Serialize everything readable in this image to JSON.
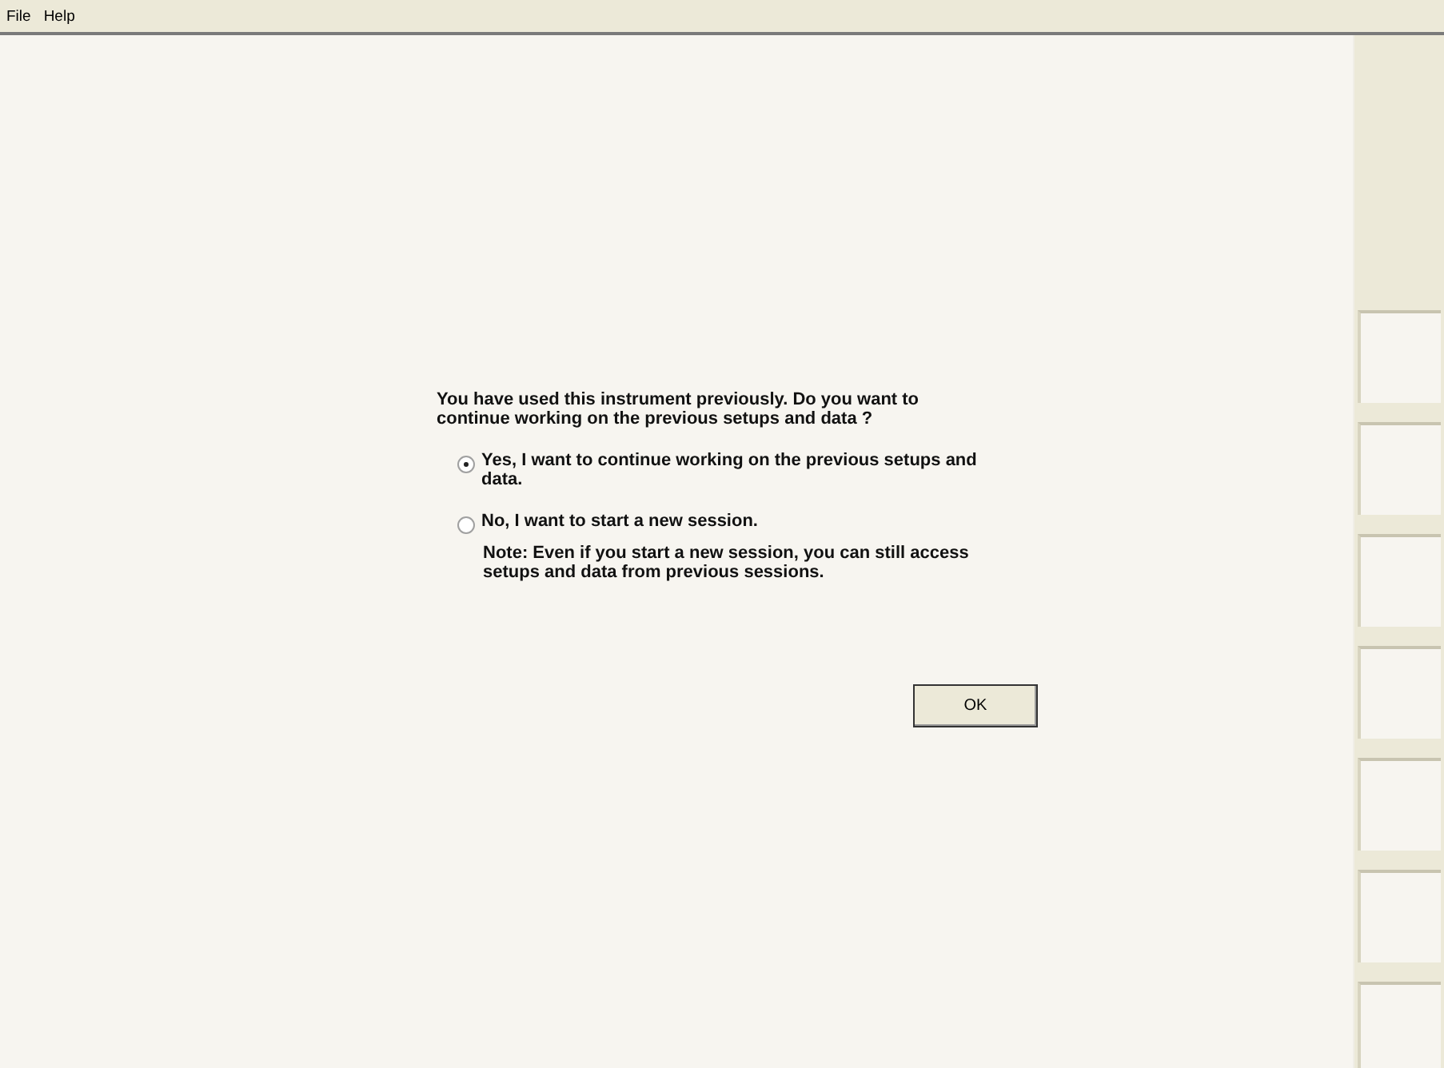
{
  "menu": [
    "File",
    "Help"
  ],
  "dialog": {
    "question": "You have used this instrument previously. Do you want to continue working on the previous setups and data ?",
    "options": [
      {
        "label": "Yes, I want to continue working on the previous setups and data.",
        "selected": true
      },
      {
        "label": "No, I want to start a new session.",
        "selected": false,
        "note": "Note: Even if you start a new session, you can still access setups and data from previous sessions."
      }
    ],
    "ok_button": "OK"
  },
  "side_panel": {
    "buttons": [
      {
        "kind": "blank"
      },
      {
        "kind": "blank"
      },
      {
        "kind": "blank"
      },
      {
        "kind": "blank"
      },
      {
        "kind": "blank"
      },
      {
        "kind": "blank"
      },
      {
        "kind": "blank"
      }
    ]
  }
}
